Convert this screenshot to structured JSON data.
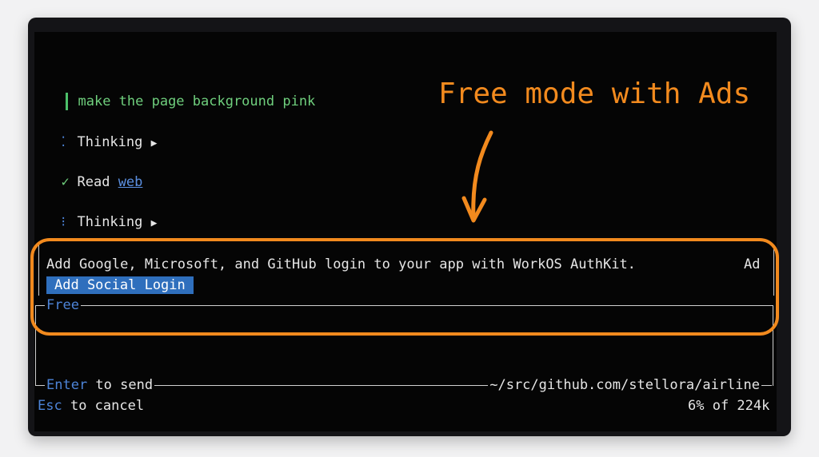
{
  "conversation": {
    "user_prompt": "make the page background pink",
    "thinking_1": "Thinking",
    "read_label": "Read",
    "read_link": "web",
    "thinking_2": "Thinking"
  },
  "icons": {
    "spinner_1": "⁚",
    "check": "✓",
    "spinner_2": "⁝",
    "expand": "▶"
  },
  "annotation": {
    "text": "Free mode with Ads"
  },
  "ad": {
    "message": "Add Google, Microsoft, and GitHub login to your app with WorkOS AuthKit.",
    "tag": "Ad",
    "button_label": "Add Social Login"
  },
  "input": {
    "mode_label": "Free",
    "enter_key": "Enter",
    "enter_text": " to send",
    "path": "~/src/github.com/stellora/airline",
    "esc_key": "Esc",
    "esc_text": " to cancel",
    "usage": "6% of 224k"
  },
  "colors": {
    "accent_orange": "#f28a1e",
    "key_blue": "#4d84d8",
    "button_blue": "#2f6fbd",
    "user_green": "#6fcf7d"
  }
}
